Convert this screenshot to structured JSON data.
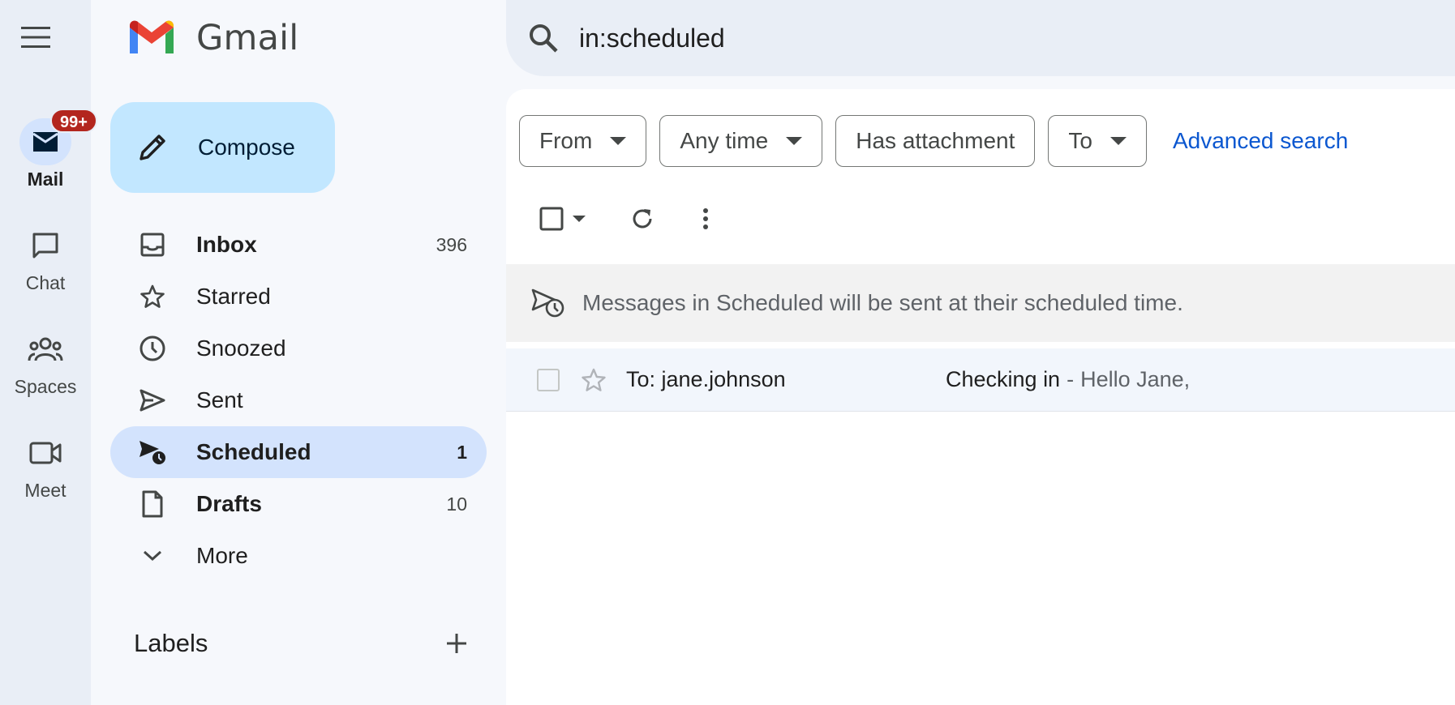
{
  "app": {
    "name": "Gmail"
  },
  "rail": {
    "items": [
      {
        "label": "Mail",
        "badge": "99+",
        "active": true
      },
      {
        "label": "Chat"
      },
      {
        "label": "Spaces"
      },
      {
        "label": "Meet"
      }
    ]
  },
  "compose": {
    "label": "Compose"
  },
  "nav": {
    "items": [
      {
        "label": "Inbox",
        "count": "396"
      },
      {
        "label": "Starred",
        "count": ""
      },
      {
        "label": "Snoozed",
        "count": ""
      },
      {
        "label": "Sent",
        "count": ""
      },
      {
        "label": "Scheduled",
        "count": "1"
      },
      {
        "label": "Drafts",
        "count": "10"
      },
      {
        "label": "More",
        "count": ""
      }
    ]
  },
  "labels": {
    "title": "Labels"
  },
  "search": {
    "value": "in:scheduled"
  },
  "filters": {
    "chips": [
      "From",
      "Any time",
      "Has attachment",
      "To"
    ],
    "advanced": "Advanced search"
  },
  "banner": {
    "text": "Messages in Scheduled will be sent at their scheduled time."
  },
  "emails": [
    {
      "to": "To: jane.johnson",
      "subject": "Checking in",
      "separator": "-",
      "snippet": "Hello Jane,"
    }
  ],
  "colors": {
    "accent_blue": "#0b57d0",
    "active_nav": "#d3e3fd",
    "compose_bg": "#c2e7ff",
    "badge_red": "#b3261e"
  }
}
